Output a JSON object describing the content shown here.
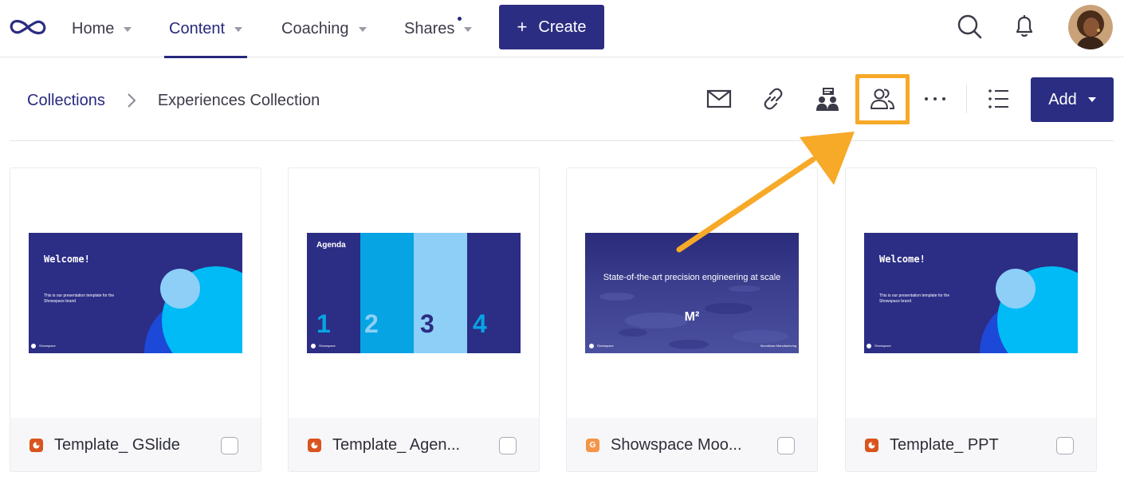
{
  "nav": {
    "items": [
      {
        "label": "Home"
      },
      {
        "label": "Content"
      },
      {
        "label": "Coaching"
      },
      {
        "label": "Shares"
      }
    ],
    "create_label": "Create"
  },
  "breadcrumb": {
    "root": "Collections",
    "current": "Experiences Collection"
  },
  "toolbar": {
    "add_label": "Add"
  },
  "cards": [
    {
      "title": "Template_ GSlide",
      "file_icon": "showspace-presentation-icon",
      "slide_heading": "Welcome!",
      "slide_body": "This is our presentation template for the Showspace brand",
      "slide_footer": "Showspace"
    },
    {
      "title": "Template_ Agen...",
      "file_icon": "showspace-presentation-icon",
      "slide_heading": "Agenda",
      "slide_numbers": [
        "1",
        "2",
        "3",
        "4"
      ],
      "slide_footer": "Showspace"
    },
    {
      "title": "Showspace Moo...",
      "file_icon": "google-slides-icon",
      "slide_heading": "State-of-the-art precision engineering at scale",
      "slide_mark": "M²",
      "slide_footer": "Showspace",
      "slide_footer_right": "Moonbase Manufacturing"
    },
    {
      "title": "Template_ PPT",
      "file_icon": "showspace-presentation-icon",
      "slide_heading": "Welcome!",
      "slide_body": "This is our presentation template for the Showspace brand",
      "slide_footer": "Showspace"
    }
  ],
  "colors": {
    "brand": "#2b2d82",
    "highlight": "#f7a928",
    "slide_bg": "#2c2d85",
    "cyan": "#00bbf5",
    "light_blue": "#8dcff7",
    "file_icon_orange": "#d9541e",
    "gslides_icon": "#f3954a"
  }
}
